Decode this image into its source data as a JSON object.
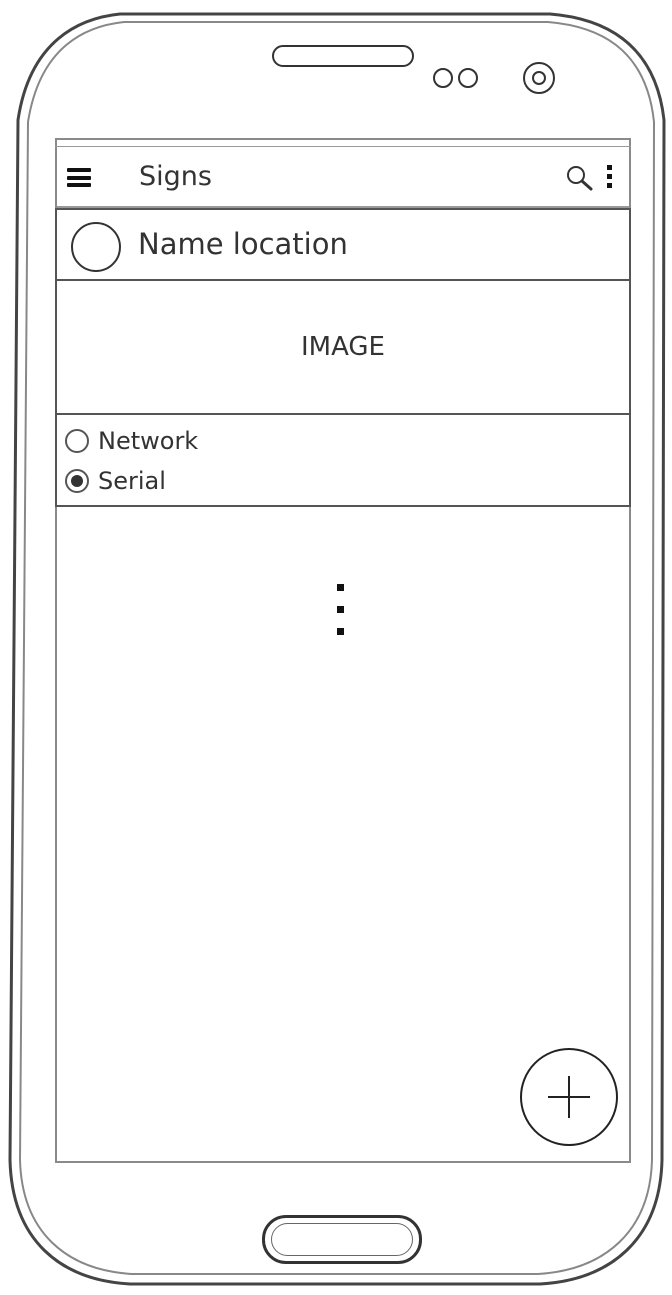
{
  "app_bar": {
    "title": "Signs",
    "menu_icon": "hamburger-menu-icon",
    "search_icon": "search-icon",
    "more_icon": "more-vert-icon"
  },
  "location": {
    "label": "Name location",
    "avatar_icon": "avatar-circle-icon"
  },
  "image_placeholder": {
    "label": "IMAGE"
  },
  "connection": {
    "options": [
      {
        "label": "Network",
        "selected": false
      },
      {
        "label": "Serial",
        "selected": true
      }
    ]
  },
  "content": {
    "ellipsis_icon": "vertical-ellipsis-icon"
  },
  "fab": {
    "icon": "plus-icon"
  }
}
